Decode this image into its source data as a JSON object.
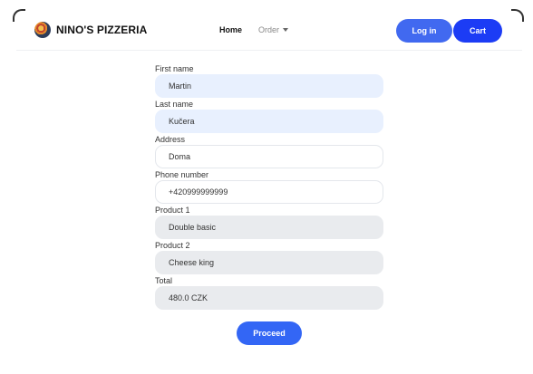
{
  "header": {
    "brand": "NINO'S PIZZERIA",
    "nav_home": "Home",
    "nav_order": "Order",
    "login_label": "Log in",
    "cart_label": "Cart"
  },
  "form": {
    "fields": [
      {
        "label": "First name",
        "value": "Martin"
      },
      {
        "label": "Last name",
        "value": "Kučera"
      },
      {
        "label": "Address",
        "value": "Doma"
      },
      {
        "label": "Phone number",
        "value": "+420999999999"
      },
      {
        "label": "Product 1",
        "value": "Double basic"
      },
      {
        "label": "Product 2",
        "value": "Cheese king"
      },
      {
        "label": "Total",
        "value": "480.0 CZK"
      }
    ],
    "proceed_label": "Proceed"
  },
  "colors": {
    "accent": "#3366f5",
    "cart": "#1c3cf5",
    "autofill_bg": "#e8f0fe",
    "readonly_bg": "#e9ebee"
  },
  "icons": {
    "logo": "pizza-logo-icon",
    "dropdown": "chevron-down-icon"
  }
}
